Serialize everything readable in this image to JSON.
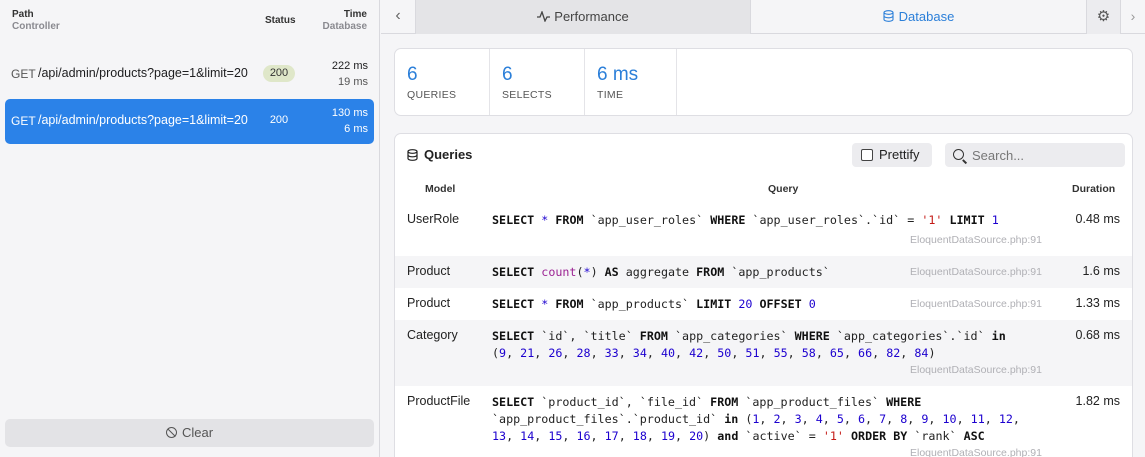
{
  "left_panel": {
    "headers": {
      "path": "Path",
      "controller": "Controller",
      "status": "Status",
      "time": "Time",
      "database": "Database"
    },
    "requests": [
      {
        "method": "GET",
        "url": "/api/admin/products?page=1&limit=20",
        "status": "200",
        "time": "222 ms",
        "db_time": "19 ms",
        "selected": false
      },
      {
        "method": "GET",
        "url": "/api/admin/products?page=1&limit=20",
        "status": "200",
        "time": "130 ms",
        "db_time": "6 ms",
        "selected": true
      }
    ],
    "clear_label": "Clear"
  },
  "tabs": {
    "back_icon": "chevron-left-icon",
    "performance_label": "Performance",
    "database_label": "Database",
    "settings_icon": "gear-icon"
  },
  "stats": [
    {
      "value": "6",
      "label": "QUERIES"
    },
    {
      "value": "6",
      "label": "SELECTS"
    },
    {
      "value": "6 ms",
      "label": "TIME"
    }
  ],
  "queries": {
    "title": "Queries",
    "prettify_label": "Prettify",
    "prettify_checked": false,
    "search_placeholder": "Search...",
    "columns": {
      "model": "Model",
      "query": "Query",
      "duration": "Duration"
    },
    "rows": [
      {
        "model": "UserRole",
        "sql": "SELECT * FROM `app_user_roles` WHERE `app_user_roles`.`id` = '1' LIMIT 1",
        "source": "EloquentDataSource.php:91",
        "duration": "0.48 ms"
      },
      {
        "model": "Product",
        "sql": "SELECT count(*) AS aggregate FROM `app_products`",
        "source": "EloquentDataSource.php:91",
        "duration": "1.6 ms"
      },
      {
        "model": "Product",
        "sql": "SELECT * FROM `app_products` LIMIT 20 OFFSET 0",
        "source": "EloquentDataSource.php:91",
        "duration": "1.33 ms"
      },
      {
        "model": "Category",
        "sql": "SELECT `id`, `title` FROM `app_categories` WHERE `app_categories`.`id` in (9, 21, 26, 28, 33, 34, 40, 42, 50, 51, 55, 58, 65, 66, 82, 84)",
        "source": "EloquentDataSource.php:91",
        "duration": "0.68 ms"
      },
      {
        "model": "ProductFile",
        "sql": "SELECT `product_id`, `file_id` FROM `app_product_files` WHERE `app_product_files`.`product_id` in (1, 2, 3, 4, 5, 6, 7, 8, 9, 10, 11, 12, 13, 14, 15, 16, 17, 18, 19, 20) and `active` = '1' ORDER BY `rank` ASC",
        "source": "EloquentDataSource.php:91",
        "duration": "1.82 ms"
      }
    ]
  },
  "colors": {
    "accent": "#2b82e8",
    "stat_value": "#2b7fd9",
    "status_badge": "#dfe7c9"
  }
}
